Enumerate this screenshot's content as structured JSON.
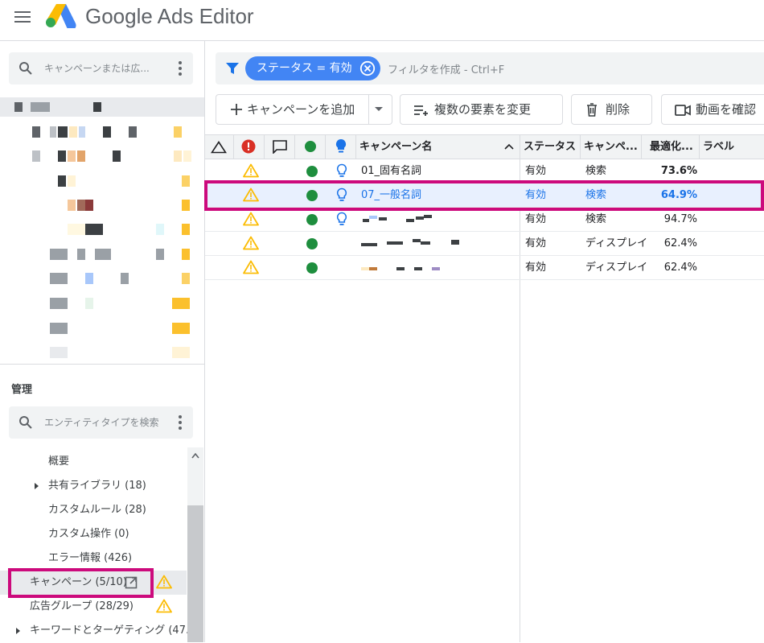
{
  "app": {
    "title": "Google Ads Editor"
  },
  "left_panel": {
    "search_placeholder": "キャンペーンまたは広...",
    "section_title": "管理",
    "entity_search_placeholder": "エンティティタイプを検索",
    "nav_items": [
      {
        "label": "概要"
      },
      {
        "label": "共有ライブラリ (18)"
      },
      {
        "label": "カスタムルール (28)"
      },
      {
        "label": "カスタム操作 (0)"
      },
      {
        "label": "エラー情報 (426)"
      },
      {
        "label": "キャンペーン (5/10)"
      },
      {
        "label": "広告グループ (28/29)"
      },
      {
        "label": "キーワードとターゲティング (47..."
      }
    ]
  },
  "filter": {
    "chip_label": "ステータス = 有効",
    "hint": "フィルタを作成 - Ctrl+F"
  },
  "toolbar": {
    "add_campaign": "キャンペーンを追加",
    "bulk_edit": "複数の要素を変更",
    "delete": "削除",
    "video_check": "動画を確認"
  },
  "grid": {
    "headers": {
      "campaign_name": "キャンペーン名",
      "status": "ステータス",
      "campaign_type": "キャンペ...",
      "optimization": "最適化...",
      "label": "ラベル"
    },
    "rows": [
      {
        "name": "01_固有名詞",
        "status": "有効",
        "type": "検索",
        "opt": "73.6%",
        "bold": true,
        "bulb": true,
        "selected": false
      },
      {
        "name": "07_一般名詞",
        "status": "有効",
        "type": "検索",
        "opt": "64.9%",
        "bold": true,
        "bulb": true,
        "selected": true
      },
      {
        "name": "",
        "status": "有効",
        "type": "検索",
        "opt": "94.7%",
        "bold": false,
        "bulb": true,
        "selected": false
      },
      {
        "name": "",
        "status": "有効",
        "type": "ディスプレイ",
        "opt": "62.4%",
        "bold": false,
        "bulb": false,
        "selected": false
      },
      {
        "name": "",
        "status": "有効",
        "type": "ディスプレイ",
        "opt": "62.4%",
        "bold": false,
        "bulb": false,
        "selected": false
      }
    ]
  },
  "colors": {
    "accent": "#4285f4",
    "highlight": "#cc0a7c",
    "status_green": "#1e8e3e",
    "warning": "#fbbc04"
  }
}
